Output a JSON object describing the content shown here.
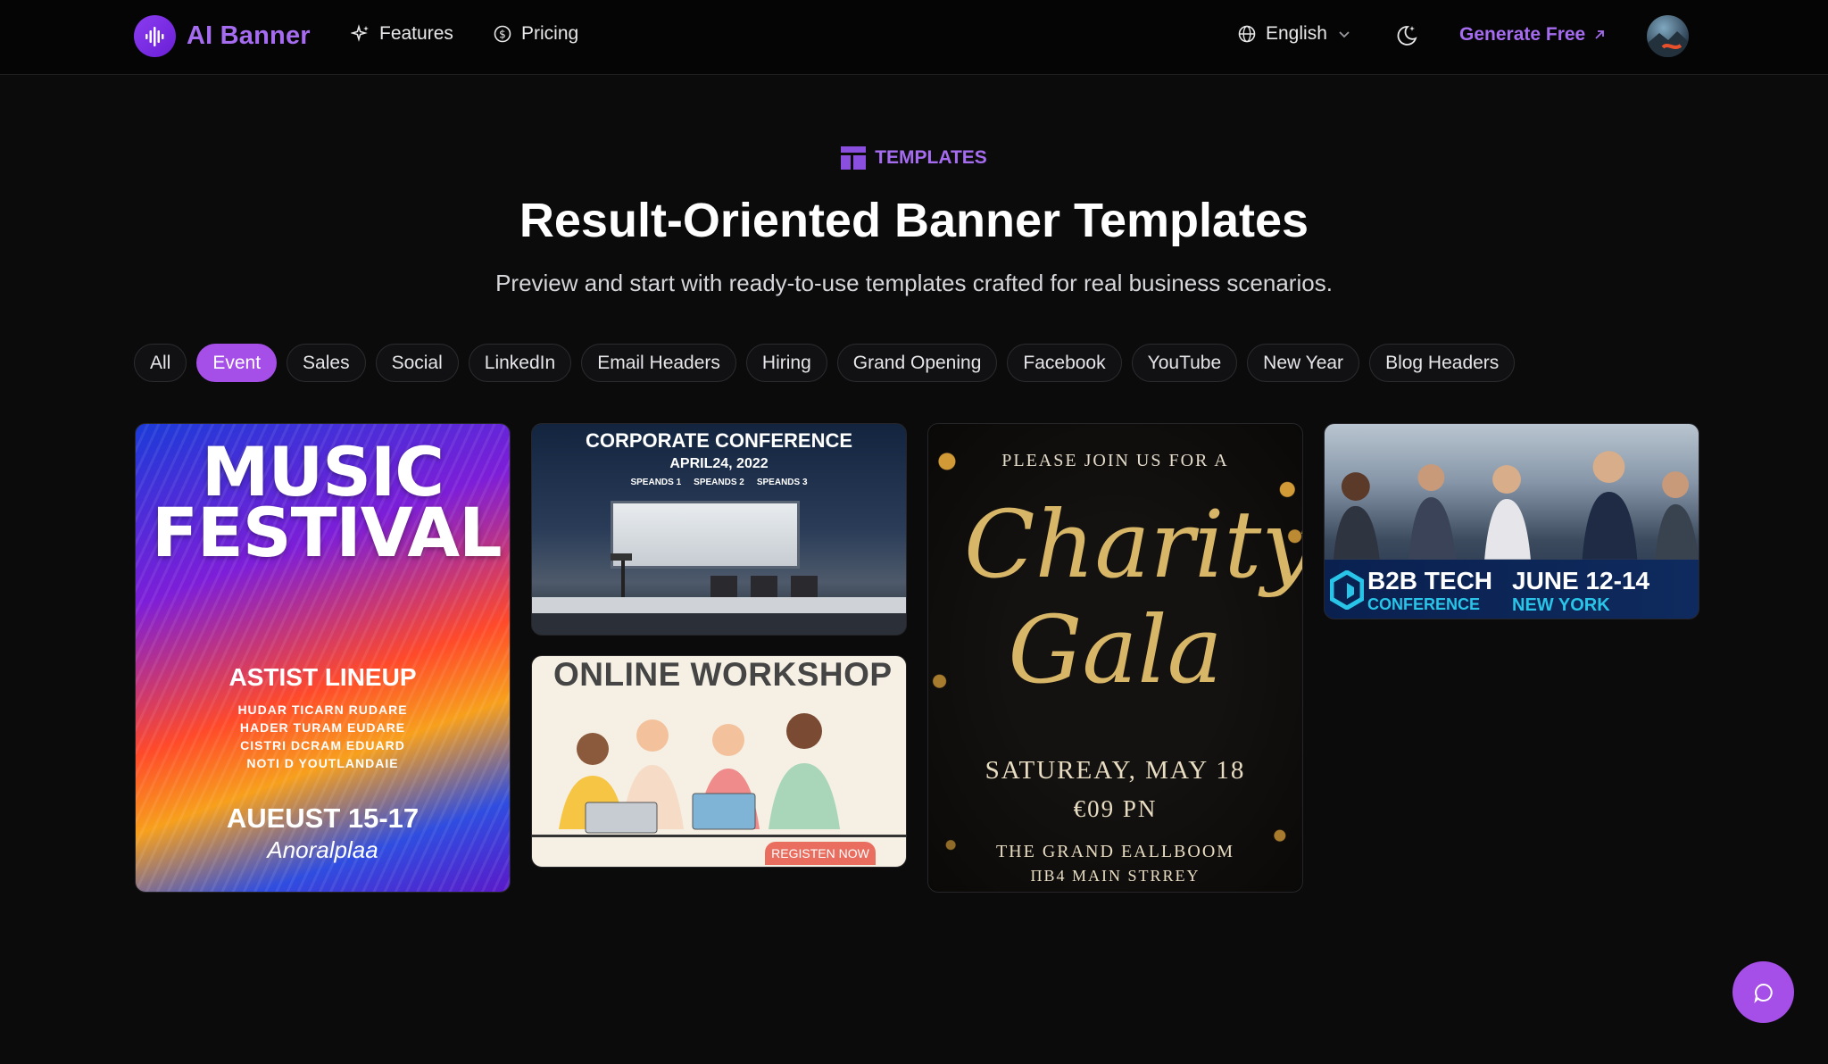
{
  "header": {
    "brand": "AI Banner",
    "nav": {
      "features": "Features",
      "pricing": "Pricing"
    },
    "language": "English",
    "cta": "Generate Free"
  },
  "hero": {
    "badge": "TEMPLATES",
    "title": "Result-Oriented Banner Templates",
    "subtitle": "Preview and start with ready-to-use templates crafted for real business scenarios."
  },
  "filters": [
    {
      "label": "All",
      "active": false
    },
    {
      "label": "Event",
      "active": true
    },
    {
      "label": "Sales",
      "active": false
    },
    {
      "label": "Social",
      "active": false
    },
    {
      "label": "LinkedIn",
      "active": false
    },
    {
      "label": "Email Headers",
      "active": false
    },
    {
      "label": "Hiring",
      "active": false
    },
    {
      "label": "Grand Opening",
      "active": false
    },
    {
      "label": "Facebook",
      "active": false
    },
    {
      "label": "YouTube",
      "active": false
    },
    {
      "label": "New Year",
      "active": false
    },
    {
      "label": "Blog Headers",
      "active": false
    }
  ],
  "cards": {
    "music": {
      "title": "MUSIC FESTIVAL",
      "lineup": "ASTIST LINEUP",
      "lines": [
        "HUDAR TICARN RUDARE",
        "HADER TURAM EUDARE",
        "CISTRI DCRAM EDUARD",
        "NOTI D YOUTLANDAIE"
      ],
      "date": "AUEUST 15-17",
      "venue": "Anoralplaa"
    },
    "corporate": {
      "title": "CORPORATE CONFERENCE",
      "date": "APRIL24, 2022",
      "speakers": [
        "SPEANDS 1",
        "SPEANDS 2",
        "SPEANDS 3"
      ]
    },
    "workshop": {
      "title": "ONLINE WORKSHOP",
      "button": "REGISTEN NOW"
    },
    "gala": {
      "intro": "PLEASE JOIN US FOR A",
      "script": "Charity Gala",
      "date": "SATUREAY, MAY 18",
      "time": "€09 PN",
      "venue": "THE GRAND EALLBOOM",
      "street": "ПB4 MAIN STRREY"
    },
    "b2b": {
      "name": "B2B TECH",
      "conference": "CONFERENCE",
      "date": "JUNE 12-14",
      "city": "NEW YORK"
    }
  },
  "colors": {
    "accent": "#a64fe8",
    "brand_text": "#a56cf0",
    "background": "#0b0b0c"
  }
}
